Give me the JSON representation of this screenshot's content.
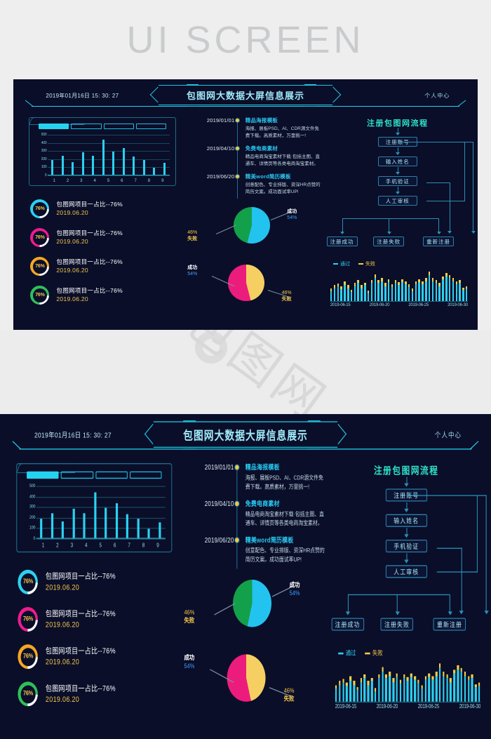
{
  "banner": {
    "text": "UI SCREEN"
  },
  "watermark": {
    "text": "包图网"
  },
  "header": {
    "datetime": "2019年01月16日 15: 30: 27",
    "title": "包图网大数据大屏信息展示",
    "user_center": "个人中心"
  },
  "segments": {
    "count": 4,
    "active_index": 0
  },
  "timeline": [
    {
      "date": "2019/01/01",
      "title": "精品海报模板",
      "desc": "海报、展板PSD、AI、CDR源文件免费下载。高质素材，万里挑一!"
    },
    {
      "date": "2019/04/10",
      "title": "免费电商素材",
      "desc": "精品电商淘宝素材下载·包括主图、直通车、详情页等各类电商淘宝素材。"
    },
    {
      "date": "2019/06/20",
      "title": "精美word简历模板",
      "desc": "创意配色、专业排版、资深HR点赞的简历文案。成功面试率UP!"
    }
  ],
  "rings": [
    {
      "percent": "76%",
      "label": "包图网项目一占比--76%",
      "date": "2019.06.20",
      "color": "#2ad2f2"
    },
    {
      "percent": "76%",
      "label": "包图网项目一占比--76%",
      "date": "2019.06.20",
      "color": "#ef1b8e"
    },
    {
      "percent": "76%",
      "label": "包图网项目一占比--76%",
      "date": "2019.06.20",
      "color": "#f5a623"
    },
    {
      "percent": "76%",
      "label": "包图网项目一占比--76%",
      "date": "2019.06.20",
      "color": "#2fbf5a"
    }
  ],
  "flow": {
    "title": "注册包图网流程",
    "steps": [
      "注册账号",
      "输入姓名",
      "手机验证",
      "人工审核"
    ],
    "results": [
      "注册成功",
      "注册失败",
      "重新注册"
    ]
  },
  "chart_data": [
    {
      "type": "bar",
      "title": "",
      "categories": [
        "1",
        "2",
        "3",
        "4",
        "5",
        "6",
        "7",
        "8",
        "9"
      ],
      "values": [
        200,
        250,
        170,
        300,
        250,
        460,
        305,
        350,
        245,
        200,
        100,
        165
      ],
      "ylabel": "",
      "xlabel": "",
      "ytick_labels": [
        "500",
        "400",
        "300",
        "200",
        "100",
        "0"
      ],
      "ylim": [
        0,
        520
      ],
      "grid": true,
      "bar_color": "#2ad2f2"
    },
    {
      "type": "pie",
      "title": "",
      "labels": [
        "成功",
        "失败"
      ],
      "values": [
        54,
        46
      ],
      "value_labels": [
        "54%",
        "46%"
      ],
      "colors": [
        "#23c3f0",
        "#13a04a"
      ],
      "label_colors": [
        "#ffffff",
        "#f3c64c"
      ],
      "legend": "right"
    },
    {
      "type": "pie",
      "title": "",
      "labels": [
        "成功",
        "失败"
      ],
      "values": [
        54,
        46
      ],
      "value_labels": [
        "54%",
        "46%"
      ],
      "colors": [
        "#ec1c7d",
        "#f6cf62"
      ],
      "label_colors": [
        "#ffffff",
        "#f3c64c"
      ],
      "legend": "left"
    },
    {
      "type": "bar",
      "subtype": "stacked",
      "title": "",
      "legend_entries": [
        "通过",
        "失败"
      ],
      "colors": [
        "#2ed0ee",
        "#f4cc4a"
      ],
      "xtick_labels": [
        "2019-06-15",
        "2019-06-20",
        "2019-06-25",
        "2019-06-30"
      ],
      "series": [
        {
          "name": "通过",
          "values": [
            20,
            26,
            30,
            24,
            33,
            26,
            18,
            30,
            36,
            26,
            32,
            16,
            36,
            46,
            36,
            40,
            30,
            38,
            28,
            36,
            32,
            38,
            34,
            28,
            20,
            34,
            38,
            34,
            40,
            52,
            40,
            36,
            30,
            44,
            50,
            46,
            40,
            34,
            36,
            22,
            24
          ]
        },
        {
          "name": "失败",
          "values": [
            6,
            6,
            5,
            6,
            6,
            6,
            5,
            6,
            6,
            6,
            5,
            5,
            6,
            7,
            6,
            6,
            6,
            6,
            6,
            6,
            6,
            6,
            6,
            6,
            5,
            6,
            6,
            6,
            6,
            7,
            6,
            6,
            6,
            6,
            7,
            6,
            6,
            6,
            6,
            5,
            5
          ]
        }
      ],
      "ylim": [
        0,
        62
      ]
    }
  ]
}
